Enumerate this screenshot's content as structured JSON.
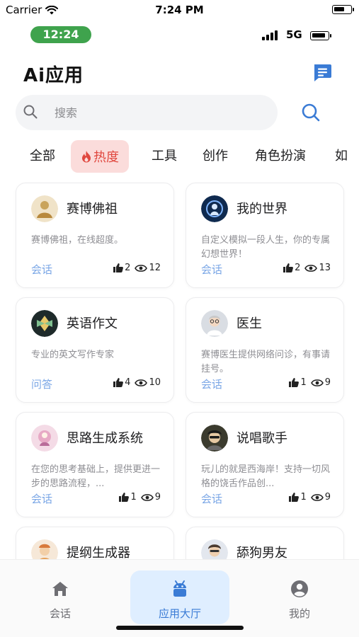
{
  "ios_status": {
    "carrier": "Carrier",
    "time": "7:24 PM"
  },
  "app_status": {
    "time": "12:24",
    "network": "5G"
  },
  "header": {
    "title": "Ai应用"
  },
  "search": {
    "placeholder": "搜索"
  },
  "categories": [
    "全部",
    "热度",
    "工具",
    "创作",
    "角色扮演",
    "如"
  ],
  "active_category": "热度",
  "cards": [
    {
      "title": "赛博佛祖",
      "desc": "赛博佛祖，在线超度。",
      "action": "会话",
      "likes": "2",
      "views": "12"
    },
    {
      "title": "我的世界",
      "desc": "自定义模拟一段人生，你的专属幻想世界！",
      "action": "会话",
      "likes": "2",
      "views": "13"
    },
    {
      "title": "英语作文",
      "desc": "专业的英文写作专家",
      "action": "问答",
      "likes": "4",
      "views": "10"
    },
    {
      "title": "医生",
      "desc": "赛博医生提供网络问诊，有事请挂号。",
      "action": "会话",
      "likes": "1",
      "views": "9"
    },
    {
      "title": "思路生成系统",
      "desc": "在您的思考基础上，提供更进一步的思路流程，...",
      "action": "会话",
      "likes": "1",
      "views": "9"
    },
    {
      "title": "说唱歌手",
      "desc": "玩儿的就是西海岸！支持一切风格的饶舌作品创...",
      "action": "会话",
      "likes": "1",
      "views": "9"
    },
    {
      "title": "提纲生成器",
      "desc": "",
      "action": "",
      "likes": "",
      "views": ""
    },
    {
      "title": "舔狗男友",
      "desc": "",
      "action": "",
      "likes": "",
      "views": ""
    }
  ],
  "tabs": [
    {
      "label": "会话",
      "icon": "home-icon"
    },
    {
      "label": "应用大厅",
      "icon": "android-icon"
    },
    {
      "label": "我的",
      "icon": "profile-icon"
    }
  ],
  "colors": {
    "accent": "#3a7bd5",
    "active_category_bg": "#fbdcdb",
    "active_category_text": "#e0483f",
    "status_pill": "#3fa34d",
    "action_link": "#7ba7e6"
  }
}
